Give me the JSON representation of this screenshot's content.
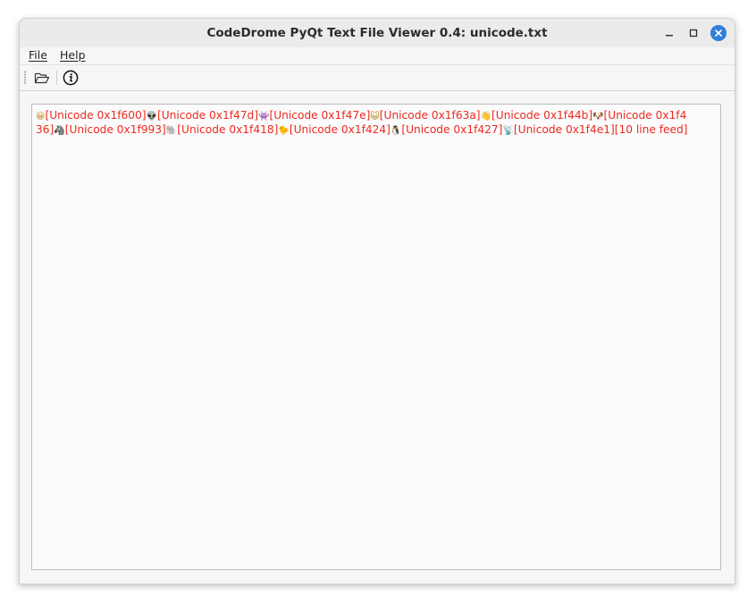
{
  "window": {
    "title": "CodeDrome PyQt Text File Viewer 0.4: unicode.txt"
  },
  "menu": {
    "file": "File",
    "help": "Help"
  },
  "toolbar": {
    "open_icon": "folder-open-icon",
    "about_icon": "info-icon"
  },
  "colors": {
    "marker_text": "#ee2a1f",
    "close_button": "#2f80d9"
  },
  "content": {
    "segments": [
      {
        "glyph": "😀",
        "label": "[Unicode 0x1f600]"
      },
      {
        "glyph": "👽",
        "label": "[Unicode 0x1f47d]"
      },
      {
        "glyph": "👾",
        "label": "[Unicode 0x1f47e]"
      },
      {
        "glyph": "😺",
        "label": "[Unicode 0x1f63a]"
      },
      {
        "glyph": "👋",
        "label": "[Unicode 0x1f44b]"
      },
      {
        "glyph": "🐶",
        "label": "[Unicode 0x1f436]"
      },
      {
        "glyph": "🦓",
        "label": "[Unicode 0x1f993]"
      },
      {
        "glyph": "🐘",
        "label": "[Unicode 0x1f418]"
      },
      {
        "glyph": "🐤",
        "label": "[Unicode 0x1f424]"
      },
      {
        "glyph": "🐧",
        "label": "[Unicode 0x1f427]"
      },
      {
        "glyph": "📡",
        "label": "[Unicode 0x1f4e1]"
      },
      {
        "glyph": "",
        "label": "[10 line feed]"
      }
    ]
  }
}
